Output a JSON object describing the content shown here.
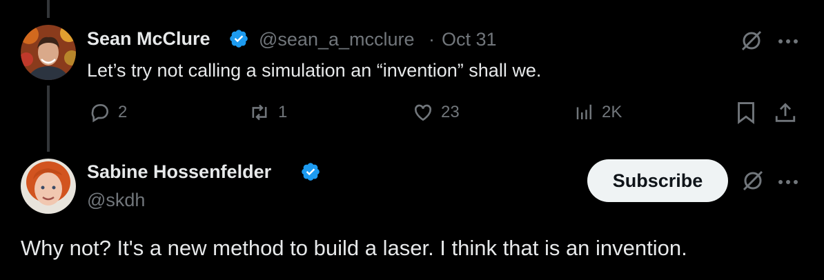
{
  "tweet1": {
    "name": "Sean McClure",
    "handle": "@sean_a_mcclure",
    "separator": "·",
    "date": "Oct 31",
    "text": "Let’s try not calling a simulation an “invention” shall we.",
    "replies": "2",
    "reposts": "1",
    "likes": "23",
    "views": "2K"
  },
  "tweet2": {
    "name": "Sabine Hossenfelder",
    "handle": "@skdh",
    "subscribe_label": "Subscribe",
    "text": "Why not? It's a new method to build a laser. I think that is an invention."
  },
  "colors": {
    "background": "#000000",
    "text": "#e7e9ea",
    "muted": "#71767b",
    "verified": "#1d9bf0",
    "button_bg": "#eff3f4"
  },
  "icons": [
    "verified-badge-icon",
    "grok-icon",
    "more-icon",
    "reply-icon",
    "repost-icon",
    "like-icon",
    "views-icon",
    "bookmark-icon",
    "share-icon"
  ]
}
